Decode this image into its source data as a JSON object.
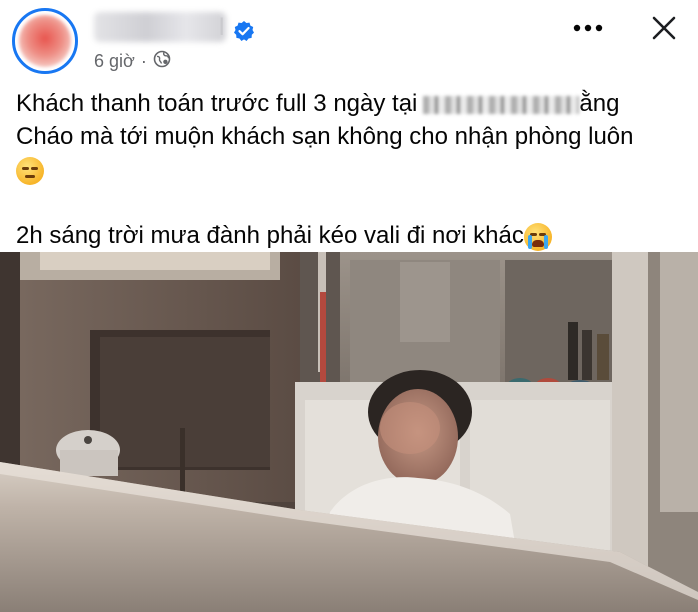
{
  "post": {
    "author_name_visible": "l",
    "time_ago": "6 giờ",
    "separator": "·",
    "text_line1_prefix": "Khách thanh toán trước full 3 ngày tại",
    "text_line1_suffix": "ằng",
    "text_line2": "Cháo mà tới muộn khách sạn không cho nhận phòng luôn",
    "text_line4": "2h sáng trời mưa đành phải kéo vali đi nơi khác"
  },
  "icons": {
    "verified": "verified-badge-icon",
    "privacy": "globe-icon",
    "more": "more-options-icon",
    "close": "close-icon",
    "emoji_unamused": "unamused-face-emoji",
    "emoji_crying": "loudly-crying-face-emoji"
  },
  "colors": {
    "accent": "#1877f2",
    "meta_text": "#65676b",
    "body_text": "#050505"
  }
}
